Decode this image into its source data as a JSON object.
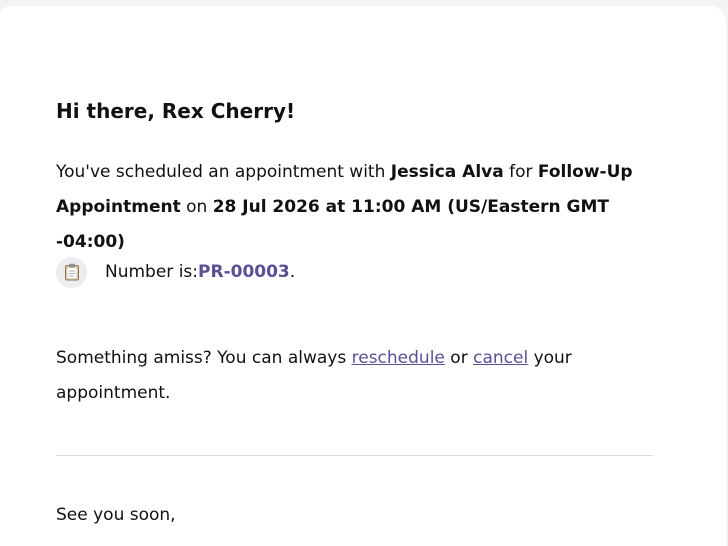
{
  "email": {
    "greeting": "Hi there, Rex Cherry!",
    "intro_prefix": "You've scheduled an appointment with ",
    "provider_name": "Jessica Alva",
    "intro_for": " for ",
    "appointment_type": "Follow-Up Appointment",
    "intro_on": " on ",
    "appointment_datetime": "28 Jul 2026 at 11:00 AM (US/Eastern GMT -04:00)",
    "number_icon": "clipboard-icon",
    "number_label": "Number is:",
    "reference_number": "PR-00003",
    "number_suffix": ".",
    "amiss_prefix": "Something amiss? You can always ",
    "reschedule_link": "reschedule",
    "or_text": " or ",
    "cancel_link": "cancel",
    "amiss_suffix": " your appointment.",
    "closing": "See you soon,"
  },
  "colors": {
    "link": "#5b4f96",
    "background": "#f3f3f6",
    "card": "#ffffff"
  }
}
